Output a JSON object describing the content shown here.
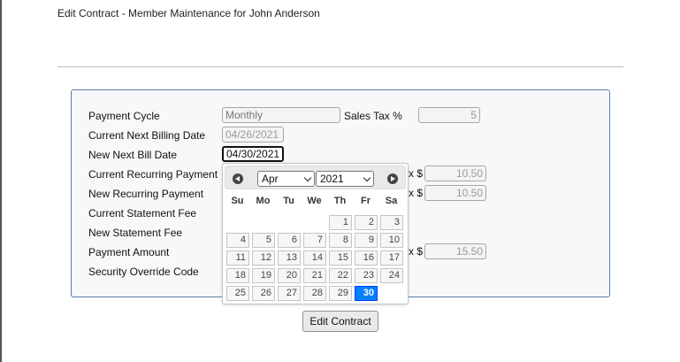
{
  "header": {
    "title": "Edit Contract - Member Maintenance for John Anderson"
  },
  "form": {
    "payment_cycle": {
      "label": "Payment Cycle",
      "placeholder": "Monthly"
    },
    "sales_tax": {
      "label": "Sales Tax %",
      "value": "5"
    },
    "current_next_billing_date": {
      "label": "Current Next Billing Date",
      "value": "04/26/2021"
    },
    "new_next_bill_date": {
      "label": "New Next Bill Date",
      "value": "04/30/2021"
    },
    "current_recurring_payment": {
      "label": "Current Recurring Payment",
      "prefix": "x $",
      "value": "10.50"
    },
    "new_recurring_payment": {
      "label": "New Recurring Payment",
      "prefix": "x $",
      "value": "10.50"
    },
    "current_statement_fee": {
      "label": "Current Statement Fee"
    },
    "new_statement_fee": {
      "label": "New Statement Fee"
    },
    "payment_amount": {
      "label": "Payment Amount",
      "prefix": "x $",
      "value": "15.50"
    },
    "security_override_code": {
      "label": "Security Override Code"
    }
  },
  "actions": {
    "edit_contract_label": "Edit Contract"
  },
  "datepicker": {
    "month": "Apr",
    "year": "2021",
    "weekdays": [
      "Su",
      "Mo",
      "Tu",
      "We",
      "Th",
      "Fr",
      "Sa"
    ],
    "leading_blanks": 4,
    "days": [
      "1",
      "2",
      "3",
      "4",
      "5",
      "6",
      "7",
      "8",
      "9",
      "10",
      "11",
      "12",
      "13",
      "14",
      "15",
      "16",
      "17",
      "18",
      "19",
      "20",
      "21",
      "22",
      "23",
      "24",
      "25",
      "26",
      "27",
      "28",
      "29",
      "30"
    ],
    "selected_day": "30"
  },
  "colors": {
    "selected_day": "#007fff",
    "panel_border": "#5b7fa6"
  }
}
